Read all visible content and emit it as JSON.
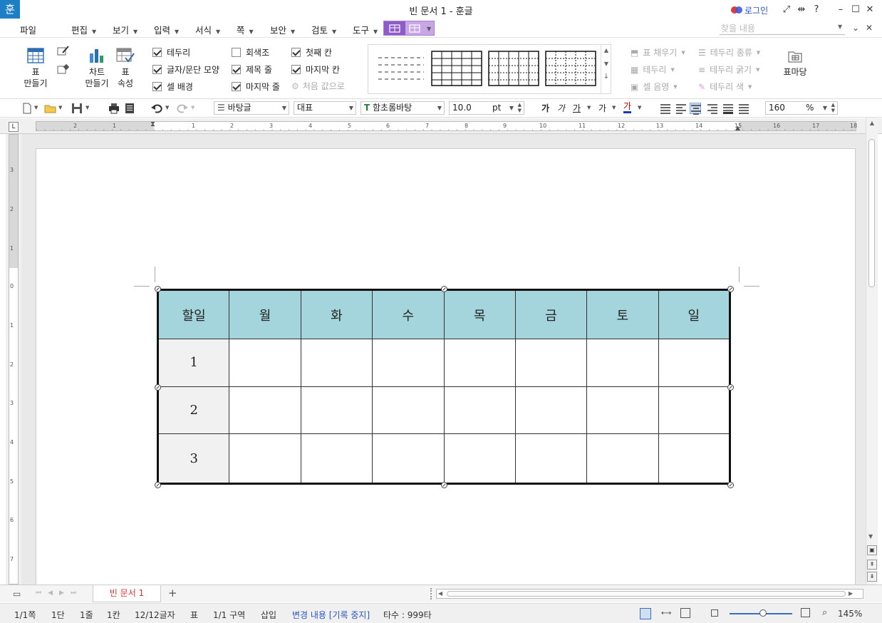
{
  "titlebar": {
    "app_icon": "훈",
    "title": "빈 문서 1 - 훈글",
    "login": "로그인",
    "help": "?"
  },
  "menu": {
    "items": [
      "파일",
      "편집",
      "보기",
      "입력",
      "서식",
      "쪽",
      "보안",
      "검토",
      "도구"
    ],
    "search_placeholder": "찾을 내용"
  },
  "ribbon": {
    "make_table": [
      "표",
      "만들기"
    ],
    "make_chart": [
      "차트",
      "만들기"
    ],
    "table_props": [
      "표",
      "속성"
    ],
    "checks": [
      {
        "label": "테두리",
        "checked": true
      },
      {
        "label": "글자/문단 모양",
        "checked": true
      },
      {
        "label": "셀 배경",
        "checked": true
      },
      {
        "label": "회색조",
        "checked": false
      },
      {
        "label": "제목 줄",
        "checked": true
      },
      {
        "label": "마지막 줄",
        "checked": true
      },
      {
        "label": "첫째 칸",
        "checked": true
      },
      {
        "label": "마지막 칸",
        "checked": true
      }
    ],
    "reset": "처음 값으로",
    "right_tools": [
      "표 채우기",
      "테두리",
      "셀 음영",
      "테두리 종류",
      "테두리 굵기",
      "테두리 색"
    ],
    "table_madang": "표마당"
  },
  "toolbar": {
    "style": "바탕글",
    "lang": "대표",
    "font": "함초롬바탕",
    "size": "10.0",
    "size_unit": "pt",
    "zoom": "160",
    "zoom_unit": "%"
  },
  "ruler": {
    "h_ticks": [
      "2",
      "1",
      "1",
      "2",
      "3",
      "4",
      "5",
      "6",
      "7",
      "8",
      "9",
      "10",
      "11",
      "12",
      "13",
      "14",
      "15",
      "16",
      "17",
      "18"
    ],
    "v_ticks": [
      "3",
      "2",
      "1",
      "0",
      "1",
      "2",
      "3",
      "4",
      "5",
      "6",
      "7"
    ]
  },
  "table": {
    "header": [
      "할일",
      "월",
      "화",
      "수",
      "목",
      "금",
      "토",
      "일"
    ],
    "rows": [
      "1",
      "2",
      "3"
    ],
    "header_color": "#a5d5dc"
  },
  "tabs": {
    "doc_tab": "빈 문서 1",
    "add": "+"
  },
  "status": {
    "page": "1/1쪽",
    "column": "1단",
    "line": "1줄",
    "cell": "1칸",
    "chars": "12/12글자",
    "table": "표",
    "section": "1/1 구역",
    "mode": "삽입",
    "changes": "변경 내용 [기록 중지]",
    "typing": "타수 : 999타",
    "zoom": "145%"
  }
}
